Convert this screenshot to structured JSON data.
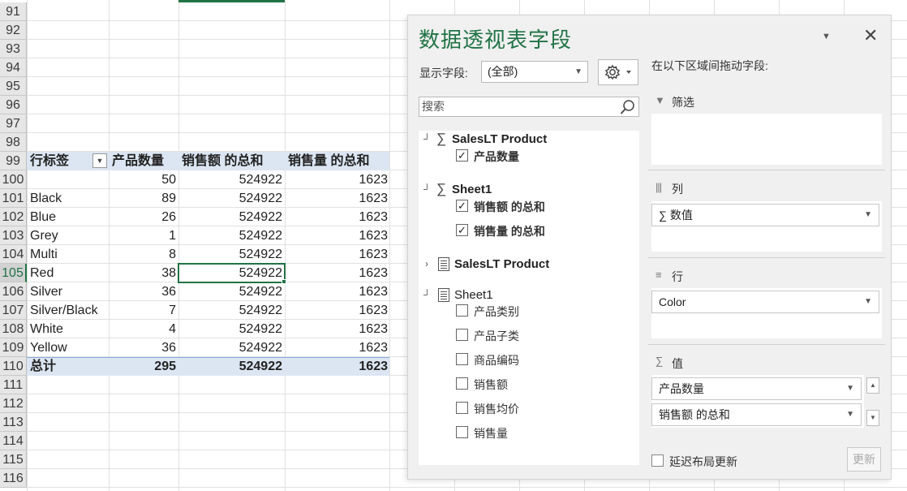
{
  "sheet": {
    "row_numbers": [
      "91",
      "92",
      "93",
      "94",
      "95",
      "96",
      "97",
      "98",
      "99",
      "100",
      "101",
      "102",
      "103",
      "104",
      "105",
      "106",
      "107",
      "108",
      "109",
      "110",
      "111",
      "112",
      "113",
      "114",
      "115",
      "116"
    ],
    "selected_row": "105",
    "pivot": {
      "headers": {
        "row_label": "行标签",
        "qty": "产品数量",
        "sales": "销售额 的总和",
        "volume": "销售量 的总和"
      },
      "rows": [
        {
          "label": "",
          "qty": "50",
          "sales": "524922",
          "volume": "1623"
        },
        {
          "label": "Black",
          "qty": "89",
          "sales": "524922",
          "volume": "1623"
        },
        {
          "label": "Blue",
          "qty": "26",
          "sales": "524922",
          "volume": "1623"
        },
        {
          "label": "Grey",
          "qty": "1",
          "sales": "524922",
          "volume": "1623"
        },
        {
          "label": "Multi",
          "qty": "8",
          "sales": "524922",
          "volume": "1623"
        },
        {
          "label": "Red",
          "qty": "38",
          "sales": "524922",
          "volume": "1623"
        },
        {
          "label": "Silver",
          "qty": "36",
          "sales": "524922",
          "volume": "1623"
        },
        {
          "label": "Silver/Black",
          "qty": "7",
          "sales": "524922",
          "volume": "1623"
        },
        {
          "label": "White",
          "qty": "4",
          "sales": "524922",
          "volume": "1623"
        },
        {
          "label": "Yellow",
          "qty": "36",
          "sales": "524922",
          "volume": "1623"
        }
      ],
      "total": {
        "label": "总计",
        "qty": "295",
        "sales": "524922",
        "volume": "1623"
      }
    }
  },
  "pane": {
    "title": "数据透视表字段",
    "show_fields_label": "显示字段:",
    "show_fields_value": "(全部)",
    "search_placeholder": "搜索",
    "drag_hint": "在以下区域间拖动字段:",
    "tree": {
      "salesltproduct_sum": {
        "name": "SalesLT Product",
        "fields": [
          {
            "label": "产品数量",
            "checked": true
          }
        ]
      },
      "sheet1_sum": {
        "name": "Sheet1",
        "fields": [
          {
            "label": "销售额 的总和",
            "checked": true
          },
          {
            "label": "销售量 的总和",
            "checked": true
          }
        ]
      },
      "salesltproduct_table": {
        "name": "SalesLT Product"
      },
      "sheet1_table": {
        "name": "Sheet1",
        "fields": [
          {
            "label": "产品类别",
            "checked": false
          },
          {
            "label": "产品子类",
            "checked": false
          },
          {
            "label": "商品编码",
            "checked": false
          },
          {
            "label": "销售额",
            "checked": false
          },
          {
            "label": "销售均价",
            "checked": false
          },
          {
            "label": "销售量",
            "checked": false
          }
        ]
      }
    },
    "areas": {
      "filter": {
        "title": "筛选"
      },
      "columns": {
        "title": "列",
        "items": [
          "∑ 数值"
        ]
      },
      "rows": {
        "title": "行",
        "items": [
          "Color"
        ]
      },
      "values": {
        "title": "值",
        "items": [
          "产品数量",
          "销售额 的总和"
        ]
      }
    },
    "defer_label": "延迟布局更新",
    "update_label": "更新",
    "accent_color": "#217346"
  }
}
